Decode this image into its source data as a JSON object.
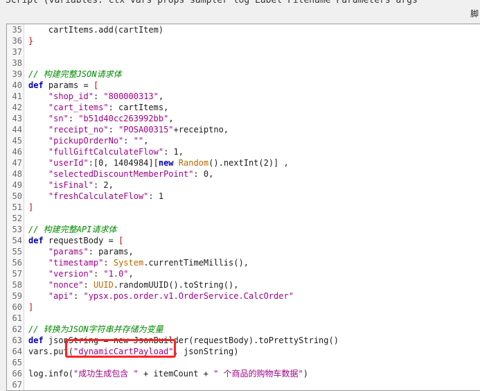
{
  "hint_bar": {
    "text": "Script (variables: ctx vars props sampler log Label Filename Parameters args",
    "suffix": "脚"
  },
  "editor": {
    "lines": [
      {
        "n": "35",
        "tokens": [
          {
            "t": "    cartItems.add(cartItem)",
            "c": "pl"
          }
        ]
      },
      {
        "n": "36",
        "tokens": [
          {
            "t": "}",
            "c": "br"
          }
        ]
      },
      {
        "n": "37",
        "tokens": []
      },
      {
        "n": "38",
        "tokens": []
      },
      {
        "n": "39",
        "tokens": [
          {
            "t": "// 构建完整JSON请求体",
            "c": "cm"
          }
        ]
      },
      {
        "n": "40",
        "tokens": [
          {
            "t": "def",
            "c": "kw"
          },
          {
            "t": " params = ",
            "c": "pl"
          },
          {
            "t": "[",
            "c": "br"
          }
        ]
      },
      {
        "n": "41",
        "tokens": [
          {
            "t": "    ",
            "c": "pl"
          },
          {
            "t": "\"shop_id\"",
            "c": "str"
          },
          {
            "t": ": ",
            "c": "pl"
          },
          {
            "t": "\"800000313\"",
            "c": "str"
          },
          {
            "t": ",",
            "c": "pl"
          }
        ]
      },
      {
        "n": "42",
        "tokens": [
          {
            "t": "    ",
            "c": "pl"
          },
          {
            "t": "\"cart_items\"",
            "c": "str"
          },
          {
            "t": ": cartItems,",
            "c": "pl"
          }
        ]
      },
      {
        "n": "43",
        "tokens": [
          {
            "t": "    ",
            "c": "pl"
          },
          {
            "t": "\"sn\"",
            "c": "str"
          },
          {
            "t": ": ",
            "c": "pl"
          },
          {
            "t": "\"b51d40cc263992bb\"",
            "c": "str"
          },
          {
            "t": ",",
            "c": "pl"
          }
        ]
      },
      {
        "n": "44",
        "tokens": [
          {
            "t": "    ",
            "c": "pl"
          },
          {
            "t": "\"receipt_no\"",
            "c": "str"
          },
          {
            "t": ": ",
            "c": "pl"
          },
          {
            "t": "\"POSA00315\"",
            "c": "str"
          },
          {
            "t": "+receiptno,",
            "c": "pl"
          }
        ]
      },
      {
        "n": "45",
        "tokens": [
          {
            "t": "    ",
            "c": "pl"
          },
          {
            "t": "\"pickupOrderNo\"",
            "c": "str"
          },
          {
            "t": ": ",
            "c": "pl"
          },
          {
            "t": "\"\"",
            "c": "str"
          },
          {
            "t": ",",
            "c": "pl"
          }
        ]
      },
      {
        "n": "46",
        "tokens": [
          {
            "t": "    ",
            "c": "pl"
          },
          {
            "t": "\"fullGiftCalculateFlow\"",
            "c": "str"
          },
          {
            "t": ": 1,",
            "c": "pl"
          }
        ]
      },
      {
        "n": "47",
        "tokens": [
          {
            "t": "    ",
            "c": "pl"
          },
          {
            "t": "\"userId\"",
            "c": "str"
          },
          {
            "t": ":[0, 1404984][",
            "c": "pl"
          },
          {
            "t": "new",
            "c": "kw"
          },
          {
            "t": " ",
            "c": "pl"
          },
          {
            "t": "Random",
            "c": "cls"
          },
          {
            "t": "().nextInt(2)] ,",
            "c": "pl"
          }
        ]
      },
      {
        "n": "48",
        "tokens": [
          {
            "t": "    ",
            "c": "pl"
          },
          {
            "t": "\"selectedDiscountMemberPoint\"",
            "c": "str"
          },
          {
            "t": ": 0,",
            "c": "pl"
          }
        ]
      },
      {
        "n": "49",
        "tokens": [
          {
            "t": "    ",
            "c": "pl"
          },
          {
            "t": "\"isFinal\"",
            "c": "str"
          },
          {
            "t": ": 2,",
            "c": "pl"
          }
        ]
      },
      {
        "n": "50",
        "tokens": [
          {
            "t": "    ",
            "c": "pl"
          },
          {
            "t": "\"freshCalculateFlow\"",
            "c": "str"
          },
          {
            "t": ": 1",
            "c": "pl"
          }
        ]
      },
      {
        "n": "51",
        "tokens": [
          {
            "t": "]",
            "c": "br"
          }
        ]
      },
      {
        "n": "52",
        "tokens": []
      },
      {
        "n": "53",
        "tokens": [
          {
            "t": "// 构建完整API请求体",
            "c": "cm"
          }
        ]
      },
      {
        "n": "54",
        "tokens": [
          {
            "t": "def",
            "c": "kw"
          },
          {
            "t": " requestBody = ",
            "c": "pl"
          },
          {
            "t": "[",
            "c": "br"
          }
        ]
      },
      {
        "n": "55",
        "tokens": [
          {
            "t": "    ",
            "c": "pl"
          },
          {
            "t": "\"params\"",
            "c": "str"
          },
          {
            "t": ": params,",
            "c": "pl"
          }
        ]
      },
      {
        "n": "56",
        "tokens": [
          {
            "t": "    ",
            "c": "pl"
          },
          {
            "t": "\"timestamp\"",
            "c": "str"
          },
          {
            "t": ": ",
            "c": "pl"
          },
          {
            "t": "System",
            "c": "cls"
          },
          {
            "t": ".currentTimeMillis(),",
            "c": "pl"
          }
        ]
      },
      {
        "n": "57",
        "tokens": [
          {
            "t": "    ",
            "c": "pl"
          },
          {
            "t": "\"version\"",
            "c": "str"
          },
          {
            "t": ": ",
            "c": "pl"
          },
          {
            "t": "\"1.0\"",
            "c": "str"
          },
          {
            "t": ",",
            "c": "pl"
          }
        ]
      },
      {
        "n": "58",
        "tokens": [
          {
            "t": "    ",
            "c": "pl"
          },
          {
            "t": "\"nonce\"",
            "c": "str"
          },
          {
            "t": ": ",
            "c": "pl"
          },
          {
            "t": "UUID",
            "c": "cls"
          },
          {
            "t": ".randomUUID().toString(),",
            "c": "pl"
          }
        ]
      },
      {
        "n": "59",
        "tokens": [
          {
            "t": "    ",
            "c": "pl"
          },
          {
            "t": "\"api\"",
            "c": "str"
          },
          {
            "t": ": ",
            "c": "pl"
          },
          {
            "t": "\"ypsx.pos.order.v1.OrderService.CalcOrder\"",
            "c": "str"
          }
        ]
      },
      {
        "n": "60",
        "tokens": [
          {
            "t": "]",
            "c": "br"
          }
        ]
      },
      {
        "n": "61",
        "tokens": []
      },
      {
        "n": "62",
        "tokens": [
          {
            "t": "// 转换为JSON字符串并存储为变量",
            "c": "cm"
          }
        ]
      },
      {
        "n": "63",
        "tokens": [
          {
            "t": "def",
            "c": "kw"
          },
          {
            "t": " jsonString = new JsonBuilder(requestBody).toPrettyString()",
            "c": "pl"
          }
        ]
      },
      {
        "n": "64",
        "tokens": [
          {
            "t": "vars.put(",
            "c": "pl"
          },
          {
            "t": "\"dynamicCartPayload\"",
            "c": "str"
          },
          {
            "t": ", jsonString)",
            "c": "pl"
          }
        ]
      },
      {
        "n": "65",
        "tokens": []
      },
      {
        "n": "66",
        "tokens": [
          {
            "t": "log.info(",
            "c": "pl"
          },
          {
            "t": "\"成功生成包含 \"",
            "c": "str"
          },
          {
            "t": " + itemCount + ",
            "c": "pl"
          },
          {
            "t": "\" 个商品的购物车数据\"",
            "c": "str"
          },
          {
            "t": ")",
            "c": "pl"
          }
        ]
      },
      {
        "n": "67",
        "tokens": []
      }
    ]
  }
}
